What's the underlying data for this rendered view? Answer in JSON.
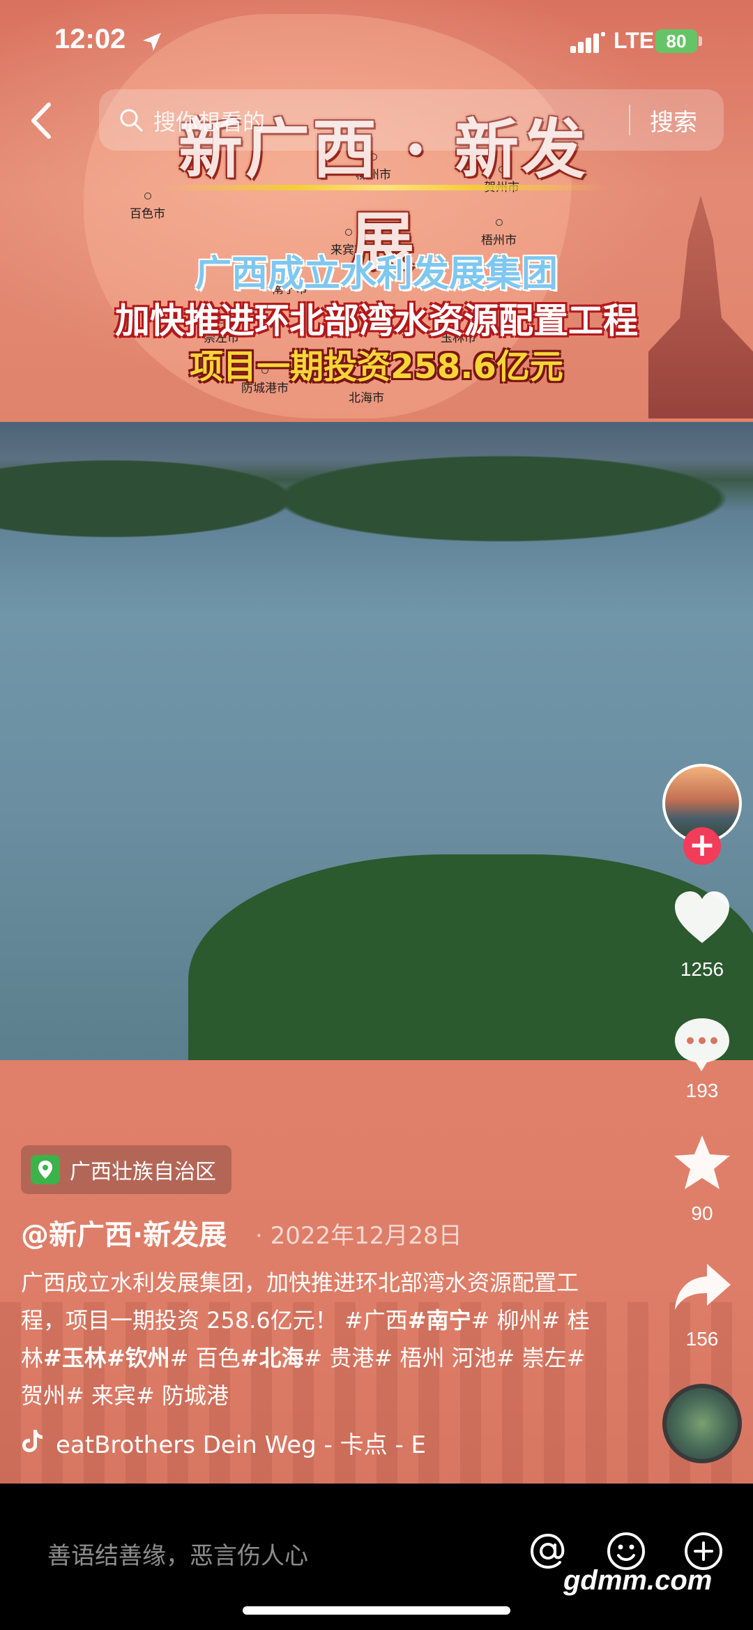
{
  "status_bar": {
    "time": "12:02",
    "network": "LTE",
    "battery": "80"
  },
  "search": {
    "placeholder": "搜你想看的",
    "button_label": "搜索"
  },
  "video": {
    "title": "新广西 · 新发展",
    "line1": "广西成立水利发展集团",
    "line2": "加快推进环北部湾水资源配置工程",
    "line3": "项目一期投资258.6亿元",
    "map_cities": [
      "百色市",
      "柳州市",
      "贺州市",
      "梧州市",
      "来宾市",
      "南宁市",
      "崇左市",
      "玉林市",
      "防城港市",
      "北海市"
    ]
  },
  "actions": {
    "likes": "1256",
    "comments": "193",
    "favorites": "90",
    "shares": "156"
  },
  "post": {
    "location": "广西壮族自治区",
    "author": "@新广西·新发展",
    "date": "· 2022年12月28日",
    "desc_1": "广西成立水利发展集团，加快推进环北部湾水资源配置工程，项目一期投资 258.6亿元！ #广西",
    "tag_nanning": "#南宁",
    "desc_2": "# 柳州# 桂林",
    "tag_yulin_qinzhou": "#玉林#钦州",
    "desc_3": "# 百色",
    "tag_beihai": "#北海",
    "desc_4": "# 贵港# 梧州 河池# 崇左# 贺州# 来宾# 防城港",
    "music": "eatBrothers    Dein Weg - 卡点 - E"
  },
  "comment_bar": {
    "placeholder": "善语结善缘，恶言伤人心"
  },
  "watermark": "gdmm.com",
  "colors": {
    "follow_badge": "#f23c59",
    "battery": "#65c466",
    "location_pin": "#3bb34a"
  }
}
